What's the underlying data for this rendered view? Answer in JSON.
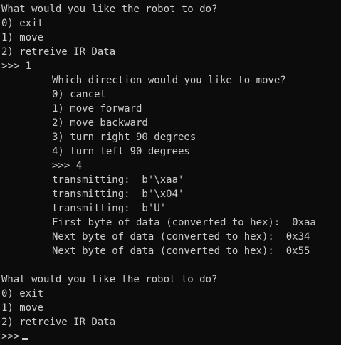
{
  "terminal": {
    "lines": [
      {
        "text": "What would you like the robot to do?",
        "indent": false
      },
      {
        "text": "0) exit",
        "indent": false
      },
      {
        "text": "1) move",
        "indent": false
      },
      {
        "text": "2) retreive IR Data",
        "indent": false
      },
      {
        "text": ">>> 1",
        "indent": false
      },
      {
        "text": "Which direction would you like to move?",
        "indent": true
      },
      {
        "text": "0) cancel",
        "indent": true
      },
      {
        "text": "1) move forward",
        "indent": true
      },
      {
        "text": "2) move backward",
        "indent": true
      },
      {
        "text": "3) turn right 90 degrees",
        "indent": true
      },
      {
        "text": "4) turn left 90 degrees",
        "indent": true
      },
      {
        "text": ">>> 4",
        "indent": true
      },
      {
        "text": "transmitting:  b'\\xaa'",
        "indent": true
      },
      {
        "text": "transmitting:  b'\\x04'",
        "indent": true
      },
      {
        "text": "transmitting:  b'U'",
        "indent": true
      },
      {
        "text": "First byte of data (converted to hex):  0xaa",
        "indent": true
      },
      {
        "text": "Next byte of data (converted to hex):  0x34",
        "indent": true
      },
      {
        "text": "Next byte of data (converted to hex):  0x55",
        "indent": true
      },
      {
        "text": "",
        "indent": false
      },
      {
        "text": "What would you like the robot to do?",
        "indent": false
      },
      {
        "text": "0) exit",
        "indent": false
      },
      {
        "text": "1) move",
        "indent": false
      },
      {
        "text": "2) retreive IR Data",
        "indent": false
      }
    ],
    "prompt": ">>>",
    "colors": {
      "background": "#0c0c0c",
      "foreground": "#cccccc"
    }
  }
}
